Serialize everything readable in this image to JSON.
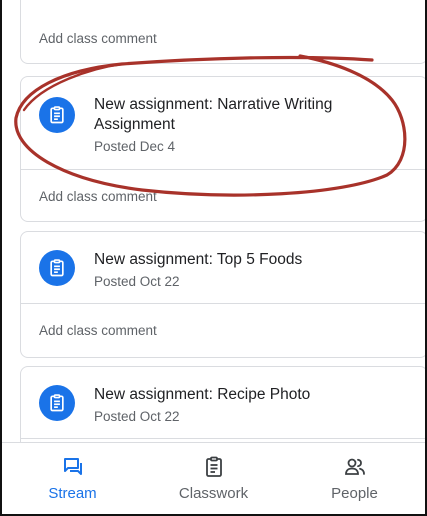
{
  "stream": {
    "top_fragment": {
      "comment_placeholder": "Add class comment"
    },
    "posts": [
      {
        "title": "New assignment: Narrative Writing Assignment",
        "date": "Posted Dec 4",
        "comment_placeholder": "Add class comment",
        "icon": "assignment-icon"
      },
      {
        "title": "New assignment: Top 5 Foods",
        "date": "Posted Oct 22",
        "comment_placeholder": "Add class comment",
        "icon": "assignment-icon"
      },
      {
        "title": "New assignment: Recipe Photo",
        "date": "Posted Oct 22",
        "comment_placeholder": "",
        "icon": "assignment-icon"
      }
    ]
  },
  "bottom_nav": {
    "items": [
      {
        "label": "Stream",
        "icon": "stream-icon",
        "active": true
      },
      {
        "label": "Classwork",
        "icon": "classwork-icon",
        "active": false
      },
      {
        "label": "People",
        "icon": "people-icon",
        "active": false
      }
    ]
  },
  "colors": {
    "accent": "#1a73e8",
    "annotation": "#a8322a",
    "text_primary": "#202124",
    "text_secondary": "#5f6368",
    "divider": "#dadce0"
  }
}
